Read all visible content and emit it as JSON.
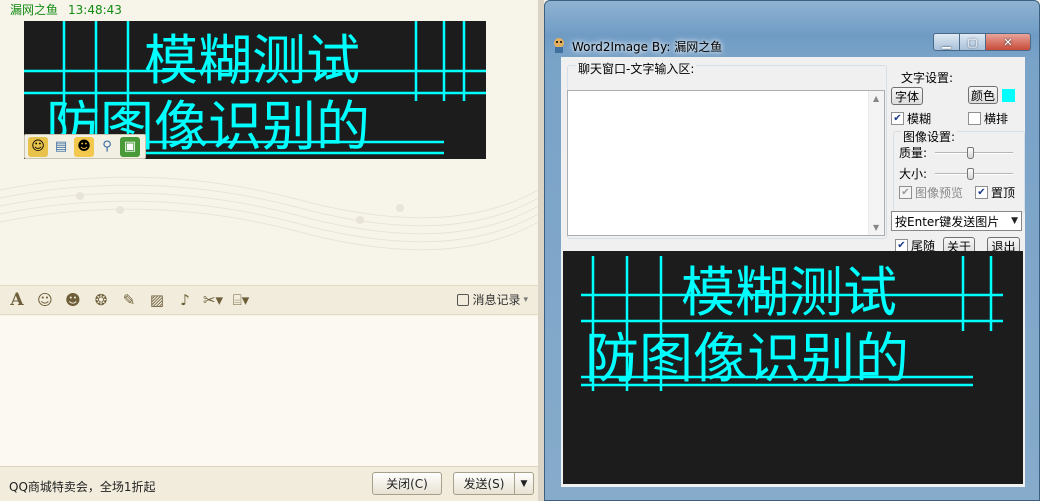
{
  "qq": {
    "sender": "漏网之鱼",
    "time": "13:48:43",
    "image_text_line1": "模糊测试",
    "image_text_line2": "防图像识别的",
    "history_label": "消息记录",
    "promo": "QQ商城特卖会，全场1折起",
    "close_label": "关闭(C)",
    "send_label": "发送(S)",
    "toolbar_icons": [
      "font-icon",
      "emoji-icon",
      "face-icon",
      "magic-face-icon",
      "edit-icon",
      "image-icon",
      "music-icon",
      "scissors-icon",
      "toolbox-icon"
    ],
    "image_toolbar_icons": [
      "emoticon-add-icon",
      "save-icon",
      "smiley-icon",
      "magnifier-icon",
      "send-image-icon"
    ]
  },
  "w2i": {
    "title": "Word2Image By: 漏网之鱼",
    "input_group_label": "聊天窗口-文字输入区:",
    "text_settings_label": "文字设置:",
    "font_button": "字体",
    "color_button": "颜色",
    "blur_label": "模糊",
    "blur_checked": true,
    "horizontal_label": "横排",
    "horizontal_checked": false,
    "image_settings_label": "图像设置:",
    "quality_label": "质量:",
    "quality_value": 0.45,
    "size_label": "大小:",
    "size_value": 0.45,
    "preview_label": "图像预览",
    "preview_checked": true,
    "top_label": "置顶",
    "top_checked": true,
    "send_mode_value": "按Enter键发送图片",
    "follow_label": "尾随",
    "follow_checked": true,
    "about_button": "关于",
    "exit_button": "退出",
    "accent_color": "#00ffff"
  }
}
